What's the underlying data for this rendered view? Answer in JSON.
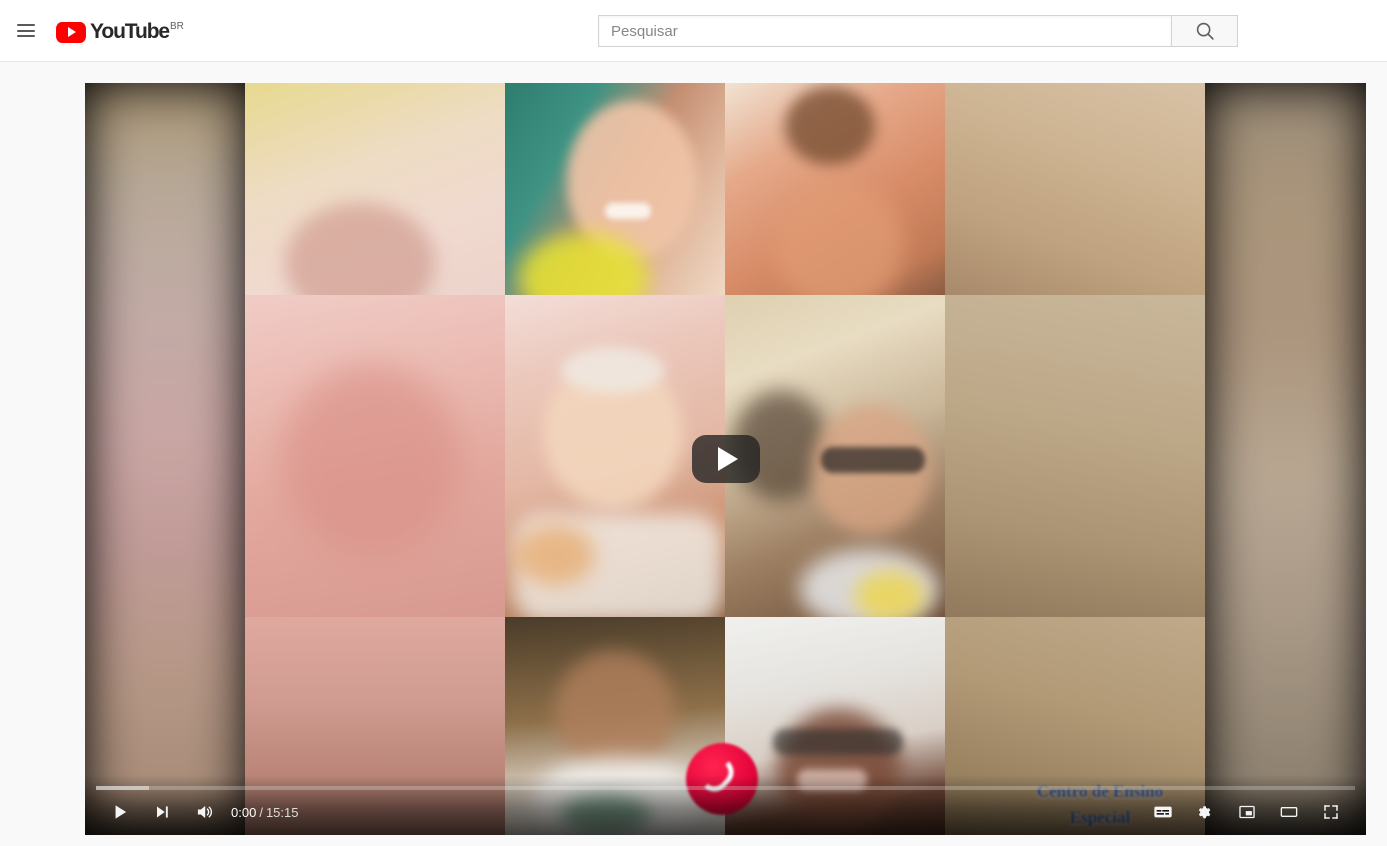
{
  "header": {
    "guide_button": "Menu",
    "logo_text": "YouTube",
    "logo_country": "BR",
    "play_icon": "youtube-play-icon",
    "menu_icon": "hamburger-menu-icon"
  },
  "search": {
    "placeholder": "Pesquisar",
    "value": "",
    "button_icon": "search-icon",
    "button_label": "Pesquisar"
  },
  "player": {
    "state": "paused",
    "big_play_icon": "play-icon",
    "controls": {
      "play_label": "Reproduzir",
      "play_icon": "play-icon",
      "next_label": "Próximo",
      "next_icon": "next-track-icon",
      "volume_label": "Silenciar",
      "volume_icon": "volume-on-icon",
      "current_time": "0:00",
      "separator": "/",
      "duration": "15:15",
      "subtitles_label": "Legendas",
      "subtitles_icon": "subtitles-icon",
      "settings_label": "Configurações",
      "settings_icon": "gear-icon",
      "miniplayer_label": "Miniplayer",
      "miniplayer_icon": "miniplayer-icon",
      "theater_label": "Modo cinema",
      "theater_icon": "theater-mode-icon",
      "fullscreen_label": "Tela cheia",
      "fullscreen_icon": "fullscreen-icon"
    },
    "progress": {
      "played_percent": 0,
      "loaded_percent": 4.2,
      "accent_color": "#ff0000"
    },
    "video": {
      "description": "video-call-grid",
      "watermark_line1": "Centro de Ensino",
      "watermark_line2": "Especial",
      "watermark_color": "#2b4f8e",
      "end_call_icon": "phone-hangup-icon",
      "end_call_color": "#e8063c",
      "grid_rows": 3,
      "grid_columns": 4
    }
  },
  "colors": {
    "brand_red": "#ff0000",
    "page_background": "#f9f9f9",
    "header_background": "#ffffff",
    "player_background": "#000000"
  }
}
